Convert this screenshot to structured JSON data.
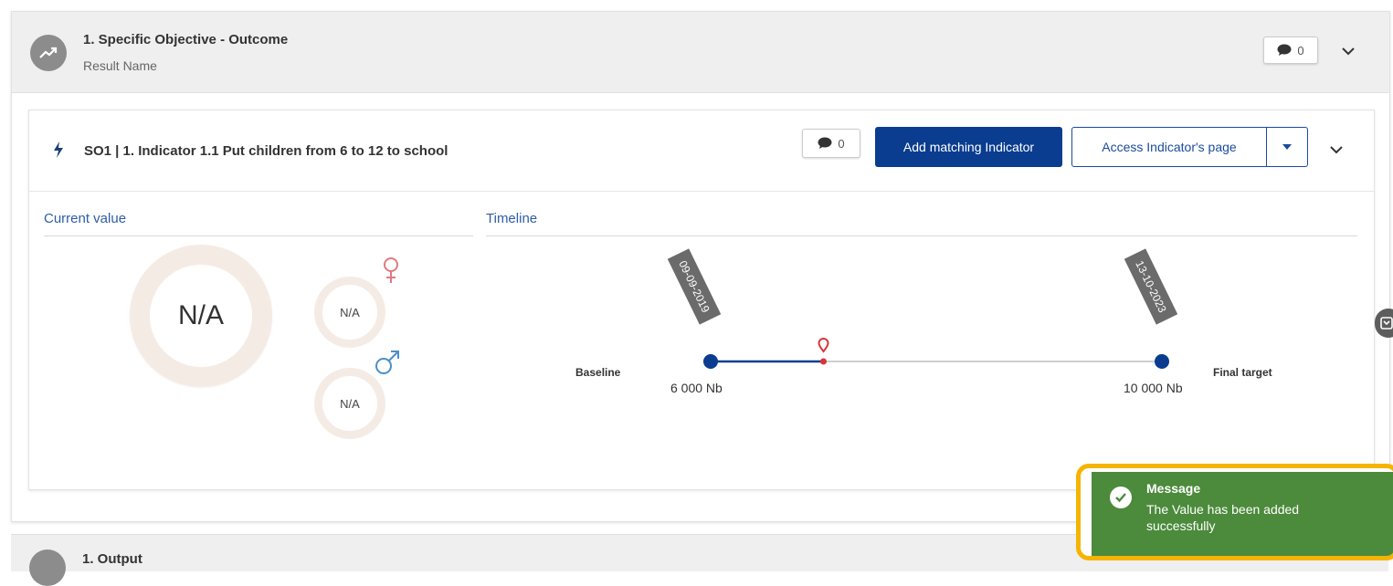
{
  "objective": {
    "title": "1. Specific Objective - Outcome",
    "subtitle": "Result Name",
    "comment_count": "0"
  },
  "indicator": {
    "title": "SO1 | 1. Indicator 1.1 Put children from 6 to 12 to school",
    "comment_count": "0",
    "add_matching_label": "Add matching Indicator",
    "access_page_label": "Access Indicator's page"
  },
  "current_value": {
    "label": "Current value",
    "total": "N/A",
    "female": "N/A",
    "male": "N/A"
  },
  "timeline": {
    "label": "Timeline",
    "baseline_label": "Baseline",
    "baseline_value": "6 000 Nb",
    "baseline_date": "09-09-2019",
    "final_label": "Final target",
    "final_value": "10 000 Nb",
    "final_date": "13-10-2023",
    "progress_fraction": 0.25
  },
  "toast": {
    "title": "Message",
    "message": "The Value has been added successfully",
    "close": "×"
  },
  "output": {
    "title": "1. Output"
  },
  "colors": {
    "primary": "#0a3d8f",
    "accent_text": "#2d5da8",
    "toast_bg": "#4c8a3c",
    "highlight": "#f5b400",
    "marker": "#d9343a",
    "female_symbol": "#e07a80",
    "male_symbol": "#4a8fc7"
  },
  "icons": [
    "trend-icon",
    "comment-icon",
    "chevron-down-icon",
    "bolt-icon",
    "caret-down-icon",
    "female-icon",
    "male-icon",
    "map-pin-icon",
    "check-circle-icon",
    "close-icon"
  ]
}
